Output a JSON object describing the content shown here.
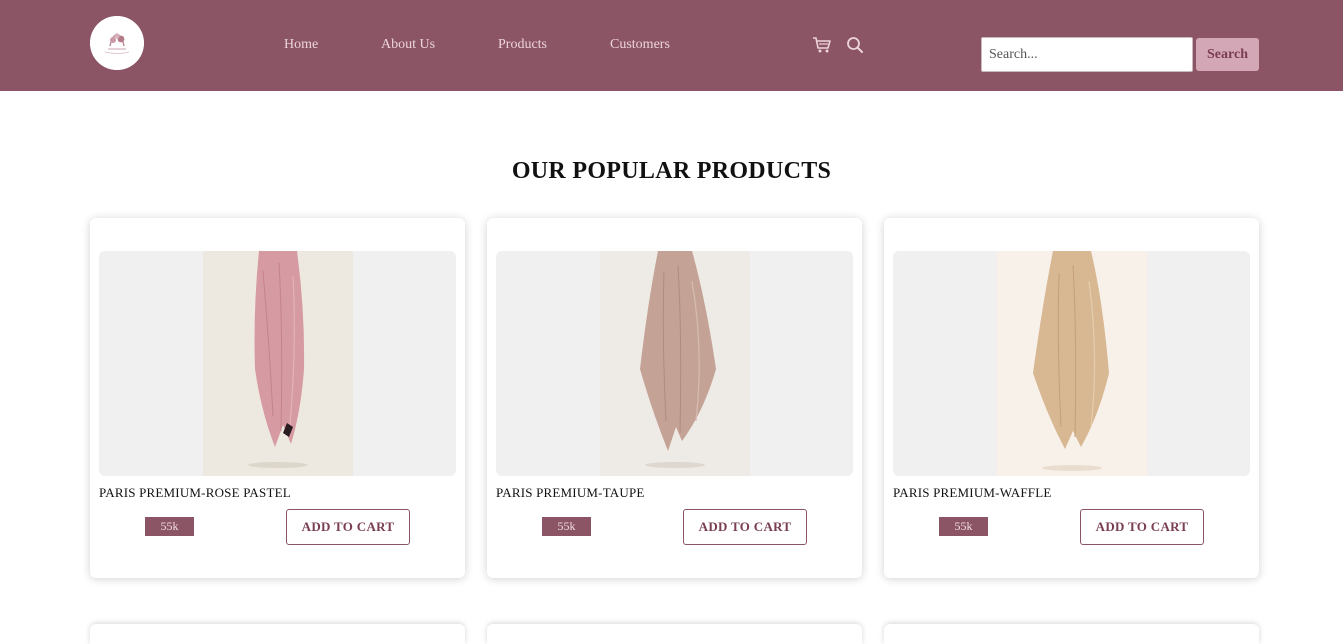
{
  "nav": {
    "links": [
      "Home",
      "About Us",
      "Products",
      "Customers"
    ],
    "icons": [
      "cart-icon",
      "search-icon"
    ],
    "search_placeholder": "Search...",
    "search_button": "Search",
    "brand_color": "#8c5566"
  },
  "section": {
    "title": "OUR POPULAR PRODUCTS"
  },
  "products": [
    {
      "name": "PARIS PREMIUM-ROSE PASTEL",
      "price": "55k",
      "button": "ADD TO CART",
      "scarf_color": "#d69aa2",
      "backdrop": "#ede9e0"
    },
    {
      "name": "PARIS PREMIUM-TAUPE",
      "price": "55k",
      "button": "ADD TO CART",
      "scarf_color": "#c4a396",
      "backdrop": "#eeeae5"
    },
    {
      "name": "PARIS PREMIUM-WAFFLE",
      "price": "55k",
      "button": "ADD TO CART",
      "scarf_color": "#d8b892",
      "backdrop": "#f8f1ea"
    }
  ],
  "colors": {
    "header": "#8c5566",
    "nav_text": "#ecd4dc",
    "search_button_bg": "#d4a7b6",
    "accent": "#7a3e52"
  }
}
